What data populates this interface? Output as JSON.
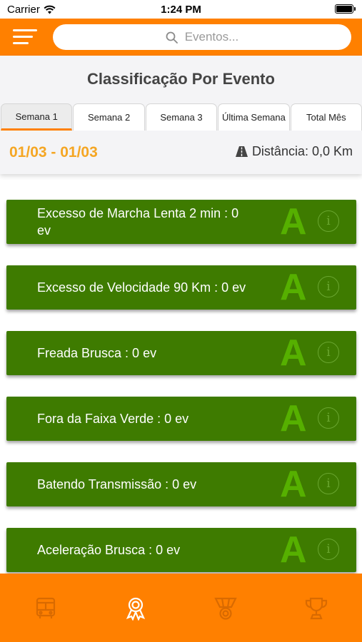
{
  "status_bar": {
    "carrier": "Carrier",
    "time": "1:24 PM"
  },
  "search": {
    "placeholder": "Eventos..."
  },
  "page": {
    "title": "Classificação Por Evento"
  },
  "tabs": [
    {
      "label": "Semana 1",
      "active": true
    },
    {
      "label": "Semana 2",
      "active": false
    },
    {
      "label": "Semana 3",
      "active": false
    },
    {
      "label": "Última Semana",
      "active": false
    },
    {
      "label": "Total Mês",
      "active": false
    }
  ],
  "summary": {
    "date_range": "01/03 - 01/03",
    "distance": "Distância: 0,0 Km"
  },
  "events": [
    {
      "label": "Excesso de Marcha Lenta 2 min : 0 ev",
      "grade": "A"
    },
    {
      "label": "Excesso de Velocidade 90 Km : 0 ev",
      "grade": "A"
    },
    {
      "label": "Freada Brusca : 0 ev",
      "grade": "A"
    },
    {
      "label": "Fora da Faixa Verde : 0 ev",
      "grade": "A"
    },
    {
      "label": "Batendo Transmissão : 0 ev",
      "grade": "A"
    },
    {
      "label": "Aceleração Brusca : 0 ev",
      "grade": "A"
    }
  ],
  "icons": {
    "menu": "hamburger-menu-icon",
    "search": "search-icon",
    "distance": "road-icon",
    "info": "info-icon",
    "nav": [
      "bus-icon",
      "award-ribbon-icon",
      "medal-icon",
      "trophy-icon"
    ]
  },
  "colors": {
    "brand_orange": "#FF8000",
    "date_orange": "#F5A623",
    "card_green": "#3E7B00",
    "grade_green": "#56B000"
  }
}
